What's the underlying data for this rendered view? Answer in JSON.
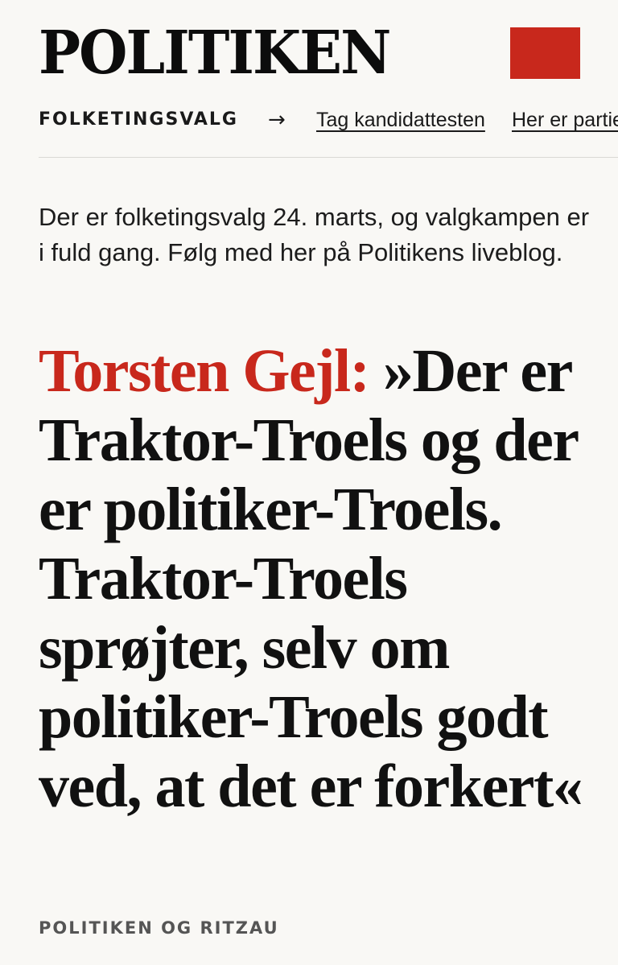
{
  "masthead": {
    "logo_text": "POLITIKEN",
    "brand_color": "#c8281c"
  },
  "nav": {
    "section_label": "FOLKETINGSVALG",
    "arrow_icon": "arrow-right-icon",
    "arrow_glyph": "→",
    "links": [
      {
        "label": "Tag kandidattesten"
      },
      {
        "label": "Her er partie"
      }
    ]
  },
  "article": {
    "intro": "Der er folketingsvalg 24. marts, og valgkampen er i fuld gang. Følg med her på Politikens liveblog.",
    "kicker": "Torsten Gejl:",
    "headline": "»Der er Traktor-Troels og der er politiker-Troels. Traktor-Troels sprøjter, selv om politiker-Troels godt ved, at det er forkert«",
    "byline": "POLITIKEN OG RITZAU"
  }
}
